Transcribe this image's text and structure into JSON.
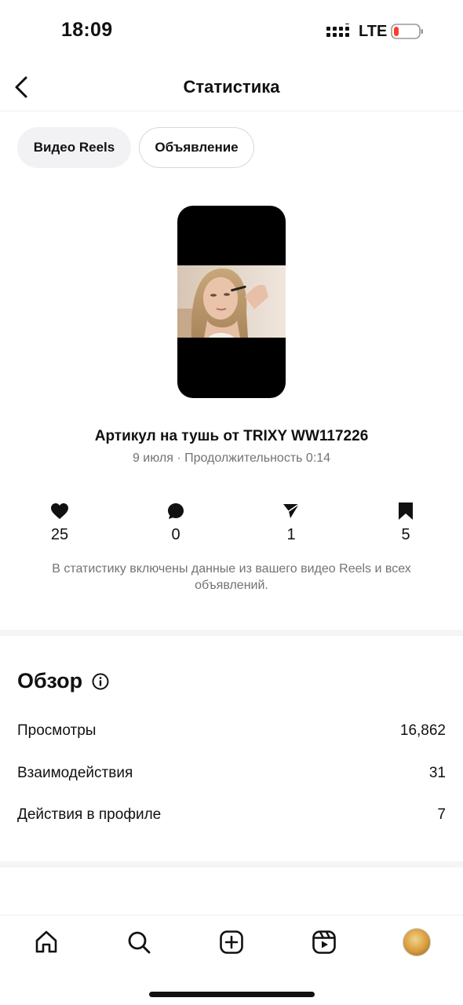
{
  "status_bar": {
    "time": "18:09",
    "network": "LTE",
    "icons": [
      "signal-icon",
      "battery-icon"
    ],
    "battery_color": "#ff3b30"
  },
  "header": {
    "title": "Статистика",
    "back_icon": "chevron-left-icon"
  },
  "tabs": [
    {
      "label": "Видео Reels",
      "active": true
    },
    {
      "label": "Объявление",
      "active": false
    }
  ],
  "reel": {
    "title": "Артикул на тушь от TRIXY WW117226",
    "meta": "9 июля · Продолжительность 0:14"
  },
  "stats": [
    {
      "icon": "heart-icon",
      "value": "25"
    },
    {
      "icon": "comment-icon",
      "value": "0"
    },
    {
      "icon": "send-icon",
      "value": "1"
    },
    {
      "icon": "bookmark-icon",
      "value": "5"
    }
  ],
  "note": "В статистику включены данные из вашего видео Reels и всех объявлений.",
  "overview": {
    "title": "Обзор",
    "info_icon": "info-icon",
    "rows": [
      {
        "label": "Просмотры",
        "value": "16,862"
      },
      {
        "label": "Взаимодействия",
        "value": "31"
      },
      {
        "label": "Действия в профиле",
        "value": "7"
      }
    ]
  },
  "bottom_nav": [
    "home-icon",
    "search-icon",
    "create-icon",
    "reels-icon",
    "profile-avatar"
  ]
}
